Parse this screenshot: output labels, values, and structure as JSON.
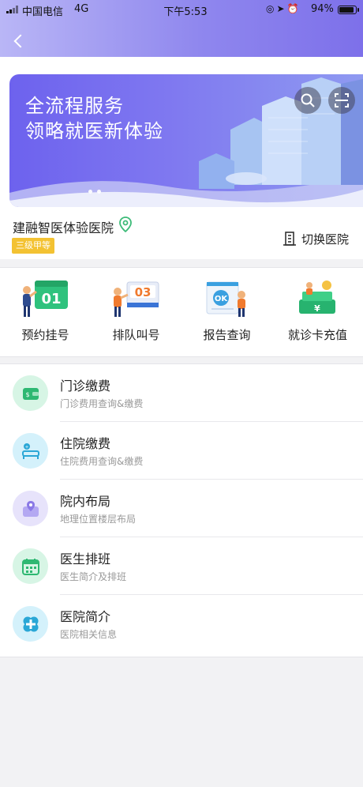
{
  "status_bar": {
    "carrier": "中国电信",
    "network": "4G",
    "time": "下午5:53",
    "battery": "94%",
    "battery_level": 0.94
  },
  "banner": {
    "title_line1": "全流程服务",
    "title_line2": "领略就医新体验"
  },
  "hospital": {
    "name": "建融智医体验医院",
    "level": "三级甲等",
    "switch_label": "切换医院"
  },
  "quick_actions": [
    {
      "label": "预约挂号",
      "number": "01",
      "accent": "#2fc27d"
    },
    {
      "label": "排队叫号",
      "number": "03",
      "accent": "#f07a2e"
    },
    {
      "label": "报告查询",
      "number": "OK",
      "accent": "#3aa0e0"
    },
    {
      "label": "就诊卡充值",
      "number": "¥",
      "accent": "#27b36f"
    }
  ],
  "services": [
    {
      "title": "门诊缴费",
      "subtitle": "门诊费用查询&缴费",
      "icon": "wallet-icon",
      "bg": "#d7f5e5",
      "color": "#2eb872"
    },
    {
      "title": "住院缴费",
      "subtitle": "住院费用查询&缴费",
      "icon": "hospital-bed-icon",
      "bg": "#d4f1fb",
      "color": "#2aa7d6"
    },
    {
      "title": "院内布局",
      "subtitle": "地理位置楼层布局",
      "icon": "map-location-icon",
      "bg": "#e7e3fb",
      "color": "#8a78e6"
    },
    {
      "title": "医生排班",
      "subtitle": "医生简介及排班",
      "icon": "calendar-icon",
      "bg": "#d7f5e5",
      "color": "#2eb872"
    },
    {
      "title": "医院简介",
      "subtitle": "医院相关信息",
      "icon": "medical-cross-icon",
      "bg": "#d4f1fb",
      "color": "#2aa7d6"
    }
  ]
}
